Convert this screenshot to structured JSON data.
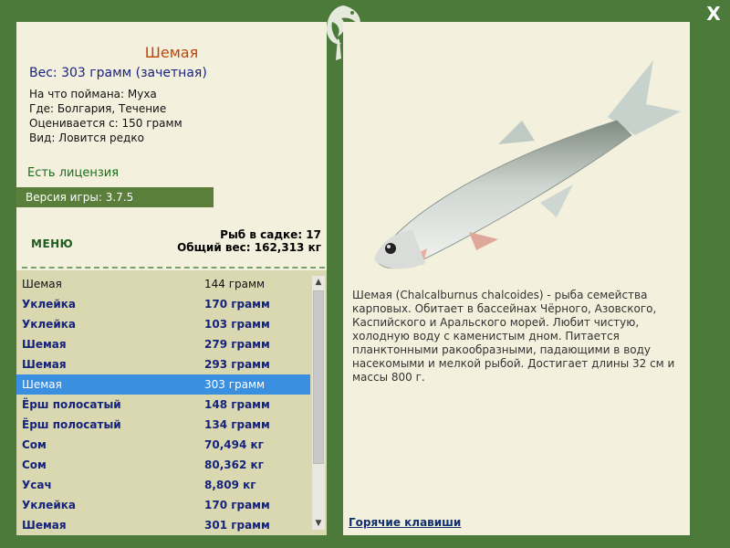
{
  "close_label": "X",
  "fish": {
    "title": "Шемая",
    "weight_line": "Вес: 303 грамм (зачетная)",
    "caught_on": "На что поймана: Муха",
    "where": "Где: Болгария, Течение",
    "valued_from": "Оценивается с: 150 грамм",
    "kind": "Вид: Ловится редко",
    "description": "Шемая (Chalcalburnus chalcoides) - рыба семейства карповых. Обитает в бассейнах Чёрного, Азовского, Каспийского и Аральского морей. Любит чистую, холодную воду с каменистым дном. Питается планктонными ракообразными, падающими в воду насекомыми и мелкой рыбой. Достигает длины 32 см и массы 800 г."
  },
  "license": "Есть лицензия",
  "version": "Версия игры: 3.7.5",
  "menu_label": "МЕНЮ",
  "net": {
    "count": "Рыб в садке: 17",
    "total": "Общий вес: 162,313 кг"
  },
  "catch_list": [
    {
      "name": "Шемая",
      "weight": "144 грамм"
    },
    {
      "name": "Уклейка",
      "weight": "170 грамм"
    },
    {
      "name": "Уклейка",
      "weight": "103 грамм"
    },
    {
      "name": "Шемая",
      "weight": "279 грамм"
    },
    {
      "name": "Шемая",
      "weight": "293 грамм"
    },
    {
      "name": "Шемая",
      "weight": "303 грамм"
    },
    {
      "name": "Ёрш полосатый",
      "weight": "148 грамм"
    },
    {
      "name": "Ёрш полосатый",
      "weight": "134 грамм"
    },
    {
      "name": "Сом",
      "weight": "70,494 кг"
    },
    {
      "name": "Сом",
      "weight": "80,362 кг"
    },
    {
      "name": "Усач",
      "weight": "8,809 кг"
    },
    {
      "name": "Уклейка",
      "weight": "170 грамм"
    },
    {
      "name": "Шемая",
      "weight": "301 грамм"
    }
  ],
  "hotkeys_label": "Горячие клавиши"
}
